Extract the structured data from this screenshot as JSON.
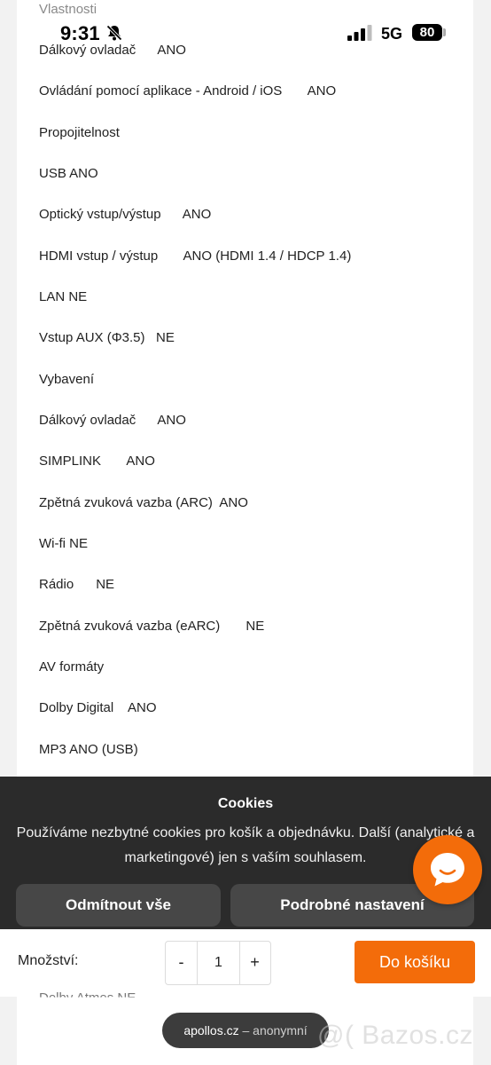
{
  "status_bar": {
    "time": "9:31",
    "network": "5G",
    "battery": "80"
  },
  "spec_section_heading": "Vlastnosti",
  "spec_lines": [
    "Dálkový ovladač      ANO",
    "Ovládání pomocí aplikace - Android / iOS       ANO",
    "Propojitelnost",
    "USB ANO",
    "Optický vstup/výstup      ANO",
    "HDMI vstup / výstup       ANO (HDMI 1.4 / HDCP 1.4)",
    "LAN NE",
    "Vstup AUX (Φ3.5)   NE",
    "Vybavení",
    "Dálkový ovladač      ANO",
    "SIMPLINK       ANO",
    "Zpětná zvuková vazba (ARC)  ANO",
    "Wi-fi NE",
    "Rádio      NE",
    "Zpětná zvuková vazba (eARC)       NE",
    "AV formáty",
    "Dolby Digital    ANO",
    "MP3 ANO (USB)"
  ],
  "cookie_banner": {
    "title": "Cookies",
    "text": "Používáme nezbytné cookies pro košík a objednávku. Další (analytické a marketingové) jen s vaším souhlasem.",
    "reject_label": "Odmítnout vše",
    "settings_label": "Podrobné nastavení"
  },
  "chat": {
    "icon": "chat-bubble-icon",
    "color": "#f36c0a"
  },
  "bottom_bar": {
    "quantity_label": "Množství:",
    "minus": "-",
    "quantity_value": "1",
    "plus": "+",
    "add_to_cart_label": "Do košíku",
    "accent": "#f36c0a"
  },
  "peek_line": "Dolby Atmos    NE",
  "browser": {
    "domain": "apollos.cz",
    "separator": " – ",
    "mode": "anonymní"
  },
  "watermark": "@( Bazos.cz"
}
